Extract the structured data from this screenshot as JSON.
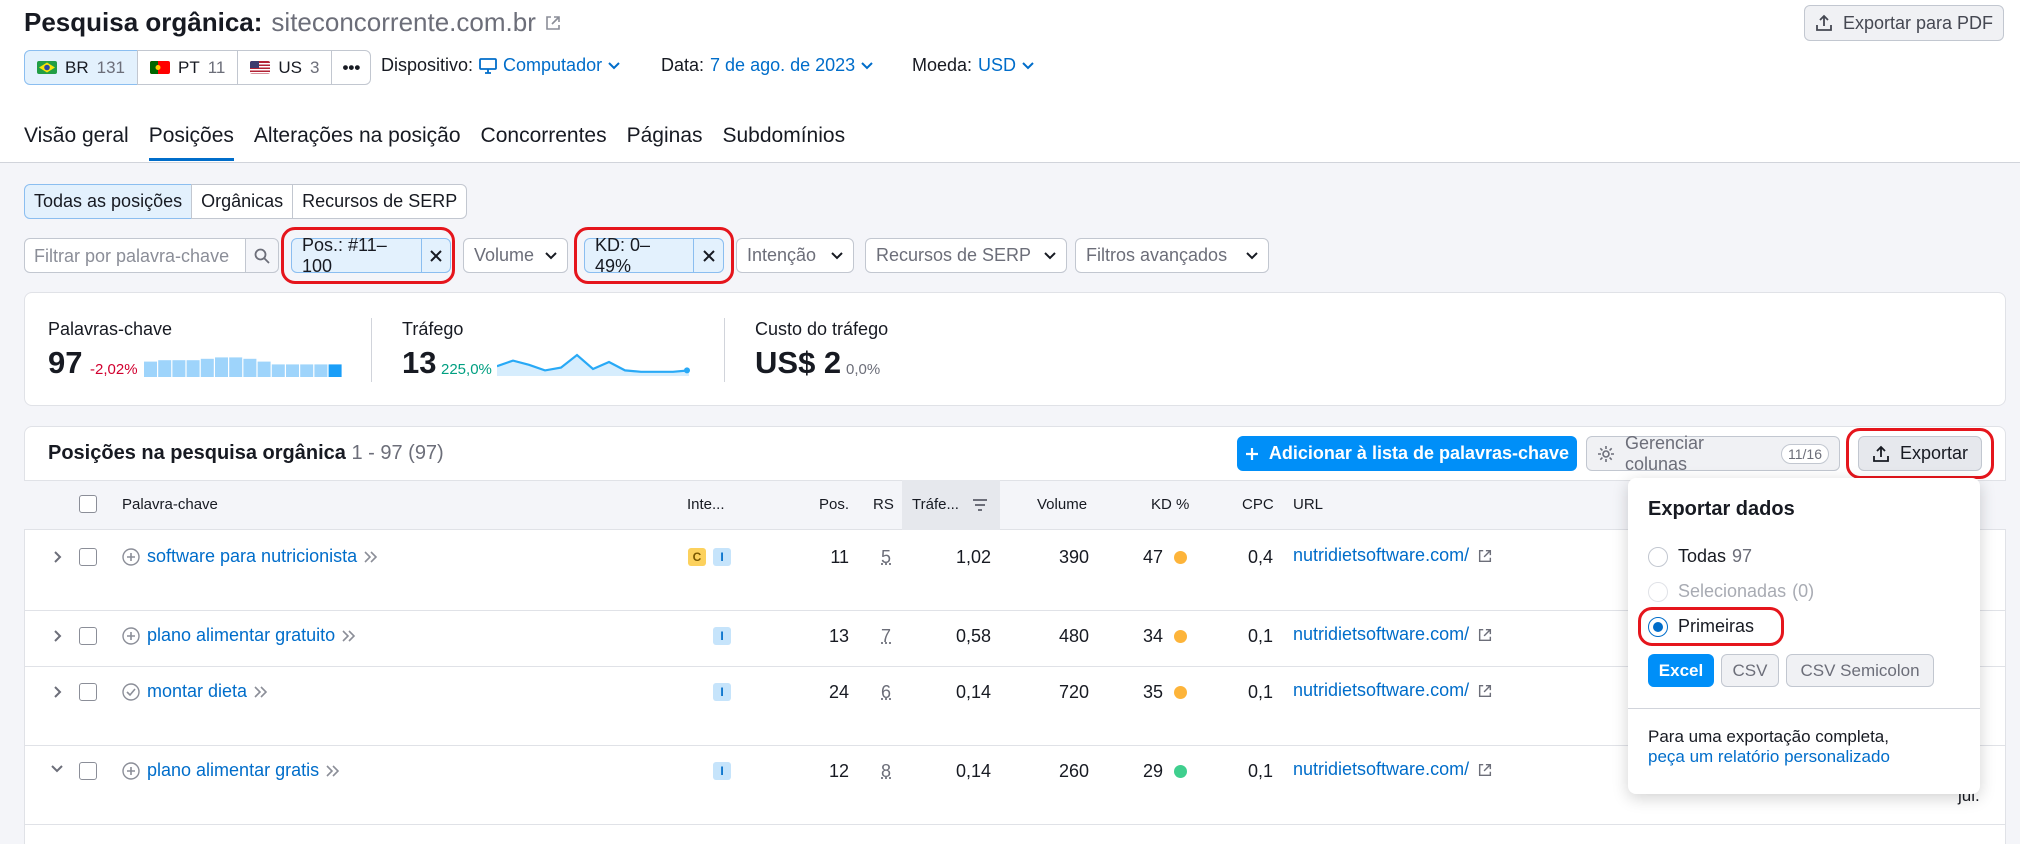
{
  "header": {
    "title": "Pesquisa orgânica:",
    "domain": "siteconcorrente.com.br",
    "pdf_button": "Exportar para PDF",
    "databases": [
      {
        "code": "BR",
        "count": "131"
      },
      {
        "code": "PT",
        "count": "11"
      },
      {
        "code": "US",
        "count": "3"
      }
    ],
    "more": "•••",
    "device_label": "Dispositivo:",
    "device_value": "Computador",
    "date_label": "Data:",
    "date_value": "7 de ago. de 2023",
    "currency_label": "Moeda:",
    "currency_value": "USD"
  },
  "tabs": [
    "Visão geral",
    "Posições",
    "Alterações na posição",
    "Concorrentes",
    "Páginas",
    "Subdomínios"
  ],
  "segments": [
    "Todas as posições",
    "Orgânicas",
    "Recursos de SERP"
  ],
  "filters": {
    "search_placeholder": "Filtrar por palavra-chave",
    "pos_chip": "Pos.: #11–100",
    "volume": "Volume",
    "kd_chip": "KD: 0–49%",
    "intent": "Intenção",
    "serp": "Recursos de SERP",
    "advanced": "Filtros avançados"
  },
  "summary": {
    "keywords_label": "Palavras-chave",
    "keywords_value": "97",
    "keywords_delta": "-2,02%",
    "keywords_bars": [
      0.55,
      0.6,
      0.6,
      0.6,
      0.65,
      0.7,
      0.7,
      0.65,
      0.55,
      0.45,
      0.45,
      0.45,
      0.45,
      0.45
    ],
    "traffic_label": "Tráfego",
    "traffic_value": "13",
    "traffic_delta": "225,0%",
    "traffic_spark": [
      0.35,
      0.55,
      0.4,
      0.2,
      0.3,
      0.75,
      0.25,
      0.5,
      0.2,
      0.15,
      0.15,
      0.15,
      0.2
    ],
    "cost_label": "Custo do tráfego",
    "cost_value": "US$ 2",
    "cost_delta": "0,0%"
  },
  "table": {
    "title": "Posições na pesquisa orgânica",
    "range": "1 - 97 (97)",
    "add_button": "Adicionar à lista de palavras-chave",
    "columns_button": "Gerenciar colunas",
    "columns_badge": "11/16",
    "export_button": "Exportar",
    "headers": {
      "keyword": "Palavra-chave",
      "intent": "Inte...",
      "pos": "Pos.",
      "rs": "RS",
      "traffic": "Tráfe...",
      "volume": "Volume",
      "kd": "KD %",
      "cpc": "CPC",
      "url": "URL"
    },
    "rows": [
      {
        "keyword": "software para nutricionista",
        "intents": [
          "C",
          "I"
        ],
        "pos": "11",
        "rs": "5",
        "traffic": "1,02",
        "volume": "390",
        "kd": "47",
        "kd_color": "#fdb43a",
        "cpc": "0,4",
        "url": "nutridietsoftware.com/"
      },
      {
        "keyword": "plano alimentar gratuito",
        "intents": [
          "I"
        ],
        "pos": "13",
        "rs": "7",
        "traffic": "0,58",
        "volume": "480",
        "kd": "34",
        "kd_color": "#fdb43a",
        "cpc": "0,1",
        "url": "nutridietsoftware.com/"
      },
      {
        "keyword": "montar dieta",
        "intents": [
          "I"
        ],
        "pos": "24",
        "rs": "6",
        "traffic": "0,14",
        "volume": "720",
        "kd": "35",
        "kd_color": "#fdb43a",
        "cpc": "0,1",
        "url": "nutridietsoftware.com/"
      },
      {
        "keyword": "plano alimentar gratis",
        "intents": [
          "I"
        ],
        "pos": "12",
        "rs": "8",
        "traffic": "0,14",
        "volume": "260",
        "kd": "29",
        "kd_color": "#3fcf8e",
        "cpc": "0,1",
        "url": "nutridietsoftware.com/"
      }
    ],
    "trailing_text": "jul."
  },
  "export_popover": {
    "title": "Exportar dados",
    "opt_all": "Todas",
    "opt_all_count": "97",
    "opt_selected": "Selecionadas",
    "opt_selected_count": "(0)",
    "opt_first": "Primeiras",
    "fmt_excel": "Excel",
    "fmt_csv": "CSV",
    "fmt_csv_semicolon": "CSV Semicolon",
    "footer_text": "Para uma exportação completa,",
    "footer_link": "peça um relatório personalizado"
  },
  "colors": {
    "accent": "#006dca",
    "primary_button": "#008ff8",
    "highlight": "#e5151c"
  }
}
